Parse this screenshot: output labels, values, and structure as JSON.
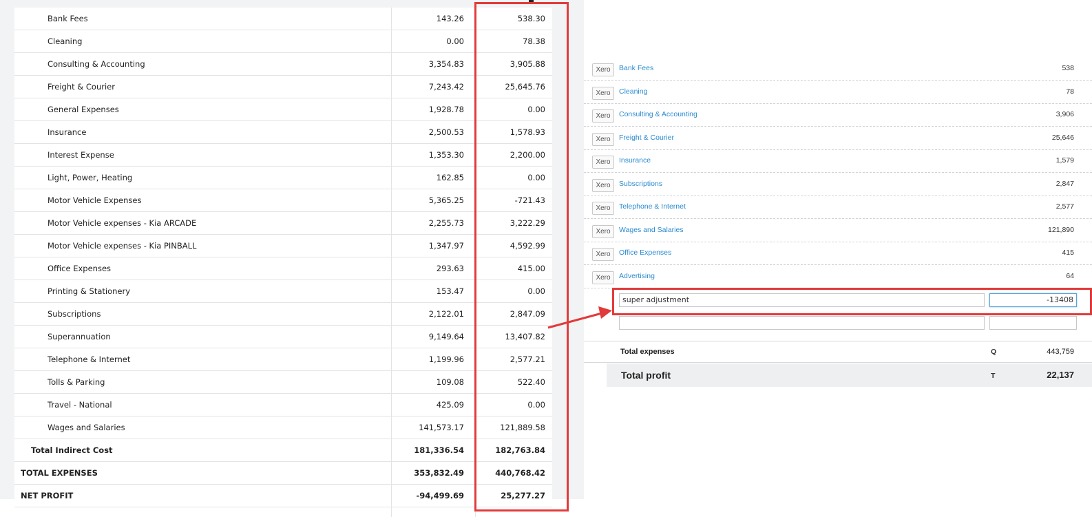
{
  "left_report": {
    "rows": [
      {
        "name": "Bank Fees",
        "col1": "143.26",
        "col2": "538.30"
      },
      {
        "name": "Cleaning",
        "col1": "0.00",
        "col2": "78.38"
      },
      {
        "name": "Consulting & Accounting",
        "col1": "3,354.83",
        "col2": "3,905.88"
      },
      {
        "name": "Freight & Courier",
        "col1": "7,243.42",
        "col2": "25,645.76"
      },
      {
        "name": "General Expenses",
        "col1": "1,928.78",
        "col2": "0.00"
      },
      {
        "name": "Insurance",
        "col1": "2,500.53",
        "col2": "1,578.93"
      },
      {
        "name": "Interest Expense",
        "col1": "1,353.30",
        "col2": "2,200.00"
      },
      {
        "name": "Light, Power, Heating",
        "col1": "162.85",
        "col2": "0.00"
      },
      {
        "name": "Motor Vehicle Expenses",
        "col1": "5,365.25",
        "col2": "-721.43"
      },
      {
        "name": "Motor Vehicle expenses - Kia ARCADE",
        "col1": "2,255.73",
        "col2": "3,222.29"
      },
      {
        "name": "Motor Vehicle expenses - Kia PINBALL",
        "col1": "1,347.97",
        "col2": "4,592.99"
      },
      {
        "name": "Office Expenses",
        "col1": "293.63",
        "col2": "415.00"
      },
      {
        "name": "Printing & Stationery",
        "col1": "153.47",
        "col2": "0.00"
      },
      {
        "name": "Subscriptions",
        "col1": "2,122.01",
        "col2": "2,847.09"
      },
      {
        "name": "Superannuation",
        "col1": "9,149.64",
        "col2": "13,407.82"
      },
      {
        "name": "Telephone & Internet",
        "col1": "1,199.96",
        "col2": "2,577.21"
      },
      {
        "name": "Tolls & Parking",
        "col1": "109.08",
        "col2": "522.40"
      },
      {
        "name": "Travel - National",
        "col1": "425.09",
        "col2": "0.00"
      },
      {
        "name": "Wages and Salaries",
        "col1": "141,573.17",
        "col2": "121,889.58"
      }
    ],
    "total_indirect": {
      "name": "Total Indirect Cost",
      "col1": "181,336.54",
      "col2": "182,763.84"
    },
    "total_expenses": {
      "name": "TOTAL EXPENSES",
      "col1": "353,832.49",
      "col2": "440,768.42"
    },
    "net_profit": {
      "name": "NET PROFIT",
      "col1": "-94,499.69",
      "col2": "25,277.27"
    }
  },
  "xero_panel": {
    "badge": "Xero",
    "rows": [
      {
        "name": "Bank Fees",
        "value": "538"
      },
      {
        "name": "Cleaning",
        "value": "78"
      },
      {
        "name": "Consulting & Accounting",
        "value": "3,906"
      },
      {
        "name": "Freight & Courier",
        "value": "25,646"
      },
      {
        "name": "Insurance",
        "value": "1,579"
      },
      {
        "name": "Subscriptions",
        "value": "2,847"
      },
      {
        "name": "Telephone & Internet",
        "value": "2,577"
      },
      {
        "name": "Wages and Salaries",
        "value": "121,890"
      },
      {
        "name": "Office Expenses",
        "value": "415"
      },
      {
        "name": "Advertising",
        "value": "64"
      }
    ],
    "adjustment_name": "super adjustment",
    "adjustment_amount": "-13408",
    "total_expenses": {
      "label": "Total expenses",
      "key": "Q",
      "value": "443,759"
    },
    "total_profit": {
      "label": "Total profit",
      "key": "T",
      "value": "22,137"
    }
  },
  "colors": {
    "highlight": "#e23a3a",
    "link": "#2b8bd0"
  }
}
